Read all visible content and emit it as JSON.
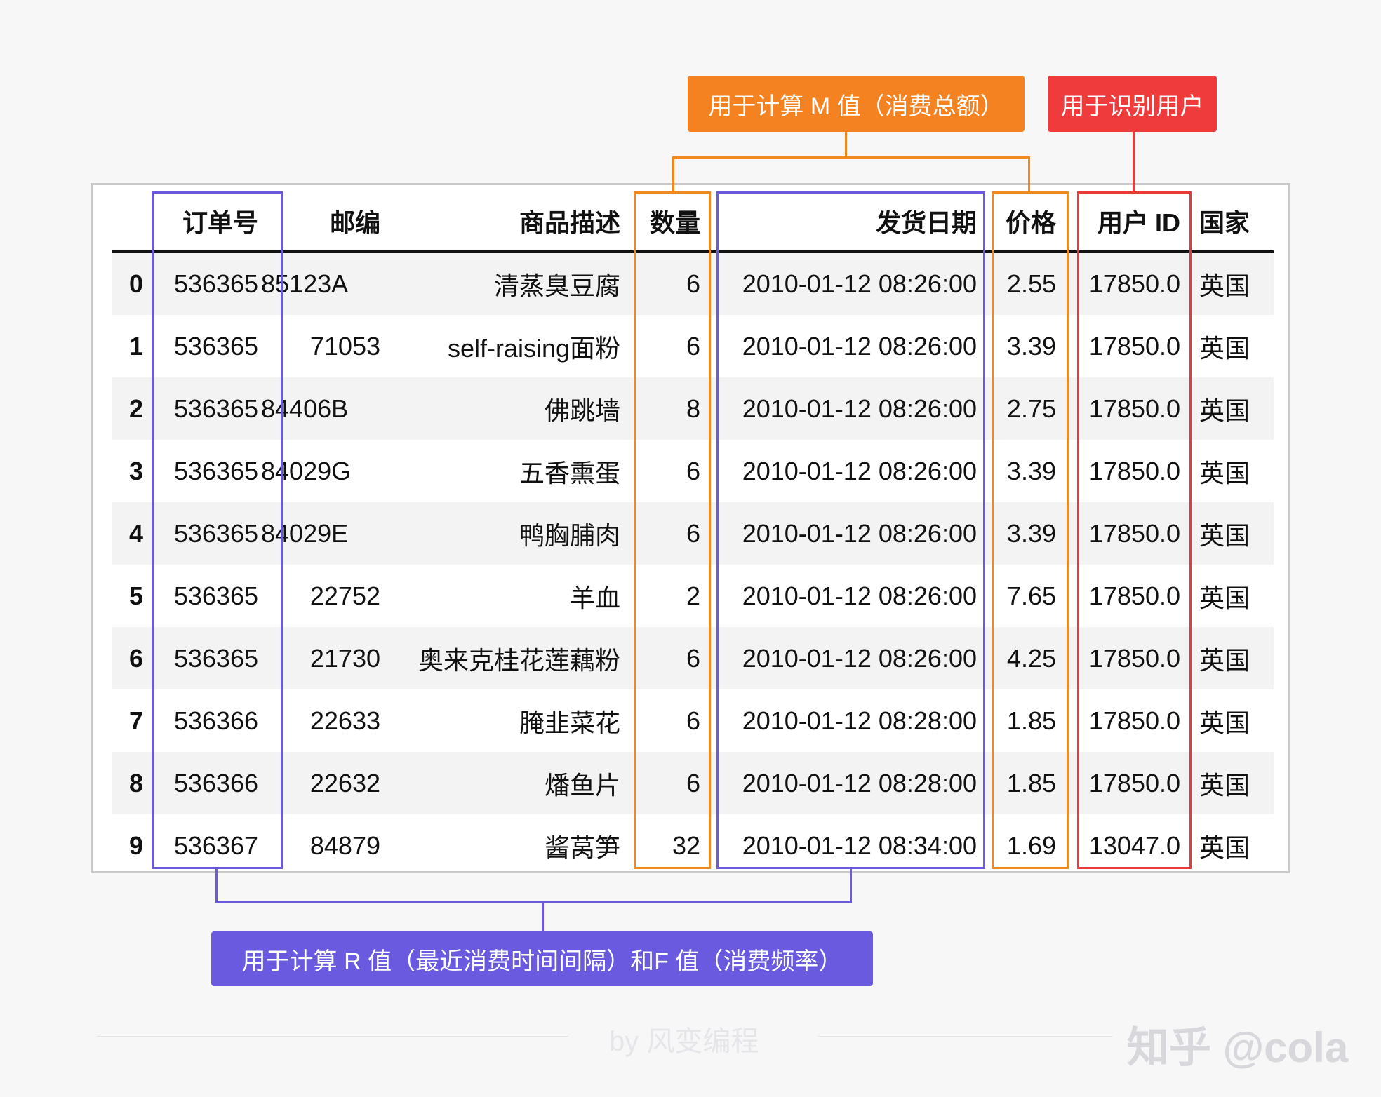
{
  "labels": {
    "m_value": "用于计算 M 值（消费总额）",
    "user_id": "用于识别用户",
    "r_f_value": "用于计算 R 值（最近消费时间间隔）和F 值（消费频率）"
  },
  "columns": [
    "",
    "订单号",
    "邮编",
    "商品描述",
    "数量",
    "发货日期",
    "价格",
    "用户 ID",
    "国家"
  ],
  "rows": [
    [
      "0",
      "536365",
      "85123A",
      "清蒸臭豆腐",
      "6",
      "2010-01-12 08:26:00",
      "2.55",
      "17850.0",
      "英国"
    ],
    [
      "1",
      "536365",
      "71053",
      "self-raising面粉",
      "6",
      "2010-01-12 08:26:00",
      "3.39",
      "17850.0",
      "英国"
    ],
    [
      "2",
      "536365",
      "84406B",
      "佛跳墙",
      "8",
      "2010-01-12 08:26:00",
      "2.75",
      "17850.0",
      "英国"
    ],
    [
      "3",
      "536365",
      "84029G",
      "五香熏蛋",
      "6",
      "2010-01-12 08:26:00",
      "3.39",
      "17850.0",
      "英国"
    ],
    [
      "4",
      "536365",
      "84029E",
      "鸭胸脯肉",
      "6",
      "2010-01-12 08:26:00",
      "3.39",
      "17850.0",
      "英国"
    ],
    [
      "5",
      "536365",
      "22752",
      "羊血",
      "2",
      "2010-01-12 08:26:00",
      "7.65",
      "17850.0",
      "英国"
    ],
    [
      "6",
      "536365",
      "21730",
      "奥来克桂花莲藕粉",
      "6",
      "2010-01-12 08:26:00",
      "4.25",
      "17850.0",
      "英国"
    ],
    [
      "7",
      "536366",
      "22633",
      "腌韭菜花",
      "6",
      "2010-01-12 08:28:00",
      "1.85",
      "17850.0",
      "英国"
    ],
    [
      "8",
      "536366",
      "22632",
      "燔鱼片",
      "6",
      "2010-01-12 08:28:00",
      "1.85",
      "17850.0",
      "英国"
    ],
    [
      "9",
      "536367",
      "84879",
      "酱莴笋",
      "32",
      "2010-01-12 08:34:00",
      "1.69",
      "13047.0",
      "英国"
    ]
  ],
  "credit": "by 风变编程",
  "watermark": "知乎 @cola",
  "colors": {
    "purple": "#6a5ae0",
    "orange": "#f08a1e",
    "red": "#e8393b"
  }
}
